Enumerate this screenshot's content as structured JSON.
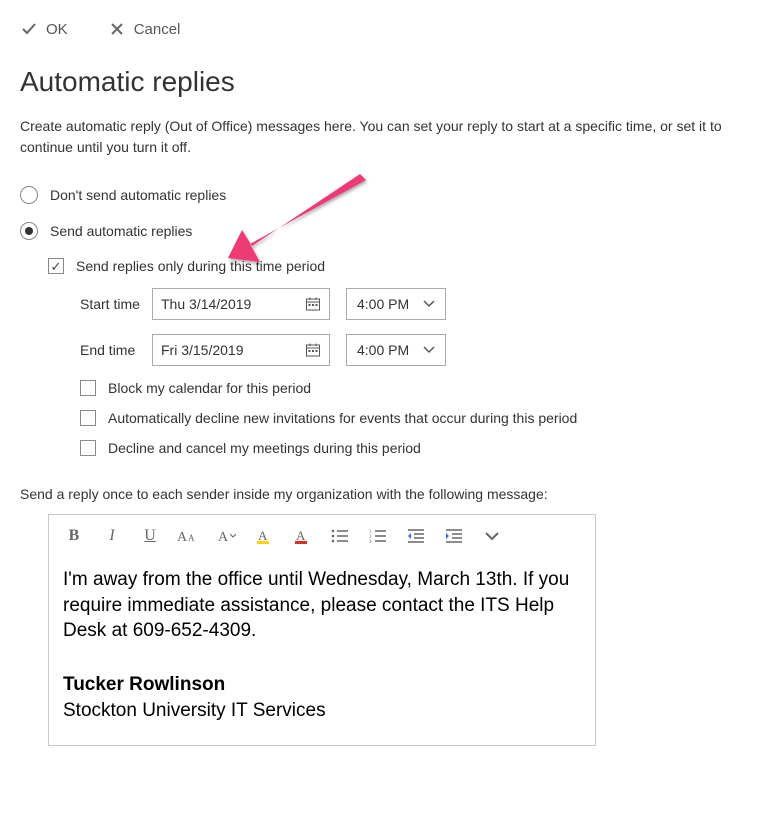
{
  "topbar": {
    "ok_label": "OK",
    "cancel_label": "Cancel"
  },
  "title": "Automatic replies",
  "description": "Create automatic reply (Out of Office) messages here. You can set your reply to start at a specific time, or set it to continue until you turn it off.",
  "radios": {
    "dont_send": "Don't send automatic replies",
    "send": "Send automatic replies",
    "selected": "send"
  },
  "time_period": {
    "checkbox_label": "Send replies only during this time period",
    "checked": true,
    "start_label": "Start time",
    "start_date": "Thu 3/14/2019",
    "start_time": "4:00 PM",
    "end_label": "End time",
    "end_date": "Fri 3/15/2019",
    "end_time": "4:00 PM"
  },
  "sub_options": {
    "block_calendar": "Block my calendar for this period",
    "auto_decline": "Automatically decline new invitations for events that occur during this period",
    "cancel_meetings": "Decline and cancel my meetings during this period"
  },
  "message_section": {
    "label": "Send a reply once to each sender inside my organization with the following message:",
    "body": "I'm away from the office until Wednesday, March 13th. If you require immediate assistance, please contact the ITS Help Desk at 609-652-4309.",
    "sig_name": "Tucker Rowlinson",
    "sig_org": "Stockton University IT Services"
  }
}
